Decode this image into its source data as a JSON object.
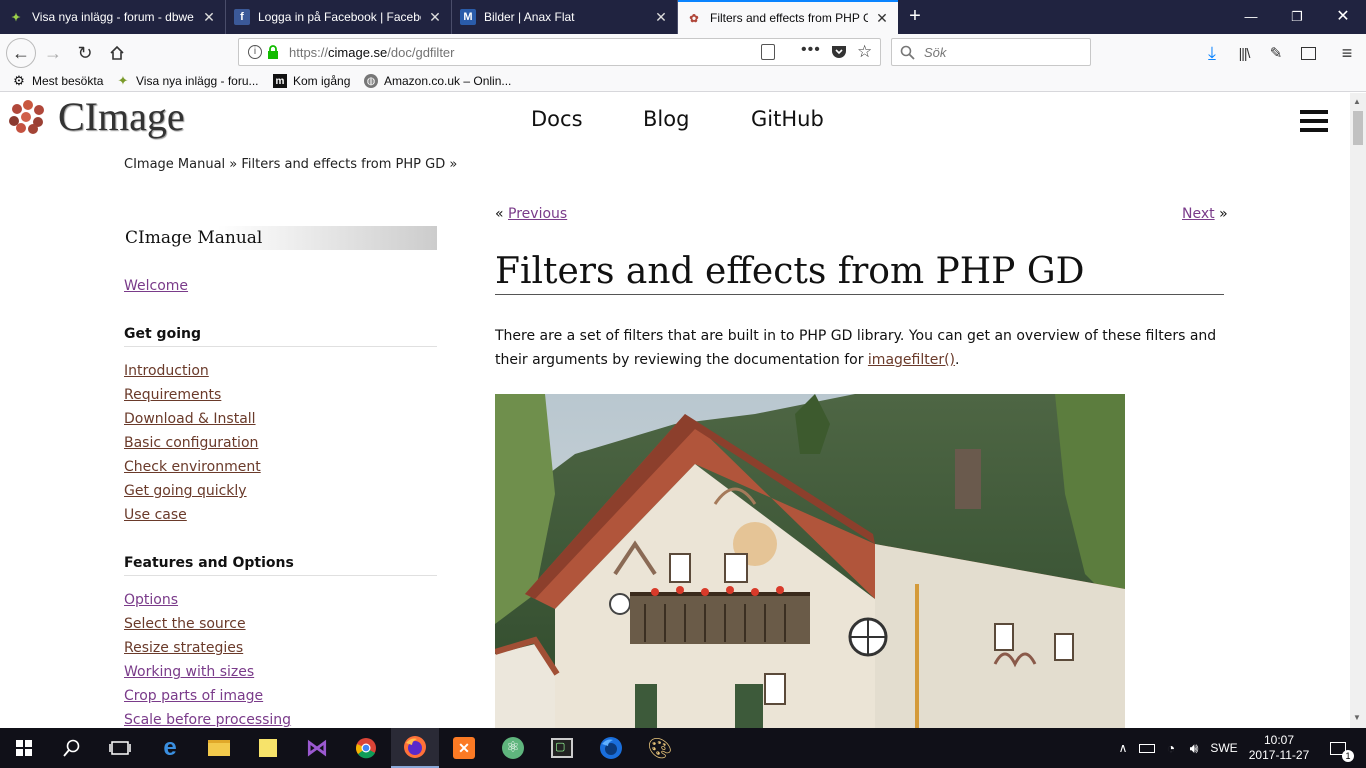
{
  "browser": {
    "tabs": [
      {
        "title": "Visa nya inlägg - forum - dbwe",
        "favicon": "dbwebb-icon"
      },
      {
        "title": "Logga in på Facebook | Facebo",
        "favicon": "facebook-icon"
      },
      {
        "title": "Bilder | Anax Flat",
        "favicon": "anax-icon"
      },
      {
        "title": "Filters and effects from PHP GD",
        "favicon": "cimage-icon",
        "active": true
      }
    ],
    "url_prefix": "https://",
    "url_host": "cimage.se",
    "url_path": "/doc/gdfilter",
    "search_placeholder": "Sök",
    "bookmarks": [
      {
        "label": "Mest besökta",
        "icon": "gear-icon"
      },
      {
        "label": "Visa nya inlägg - foru...",
        "icon": "dbwebb-icon"
      },
      {
        "label": "Kom igång",
        "icon": "m-icon"
      },
      {
        "label": "Amazon.co.uk – Onlin...",
        "icon": "globe-icon"
      }
    ]
  },
  "site": {
    "title": "CImage",
    "nav": [
      "Docs",
      "Blog",
      "GitHub"
    ],
    "breadcrumb": "CImage Manual » Filters and effects from PHP GD »"
  },
  "sidebar": {
    "heading": "CImage Manual",
    "welcome": "Welcome",
    "groups": [
      {
        "title": "Get going",
        "links": [
          "Introduction",
          "Requirements",
          "Download & Install",
          "Basic configuration",
          "Check environment",
          "Get going quickly",
          "Use case"
        ]
      },
      {
        "title": "Features and Options",
        "links": [
          "Options",
          "Select the source",
          "Resize strategies",
          "Working with sizes",
          "Crop parts of image",
          "Scale before processing"
        ]
      }
    ]
  },
  "article": {
    "prev_prefix": "«",
    "prev": "Previous",
    "next": "Next",
    "next_suffix": "»",
    "title": "Filters and effects from PHP GD",
    "para_before": "There are a set of filters that are built in to PHP GD library. You can get an overview of these filters and their arguments by reviewing the documentation for ",
    "para_link": "imagefilter()",
    "para_after": "."
  },
  "taskbar": {
    "lang": "SWE",
    "time": "10:07",
    "date": "2017-11-27",
    "notifications": "1"
  },
  "colors": {
    "tabbar": "#202340",
    "link_visited": "#7a3b8a",
    "link": "#6a3a2a",
    "accent": "#0a84ff"
  }
}
